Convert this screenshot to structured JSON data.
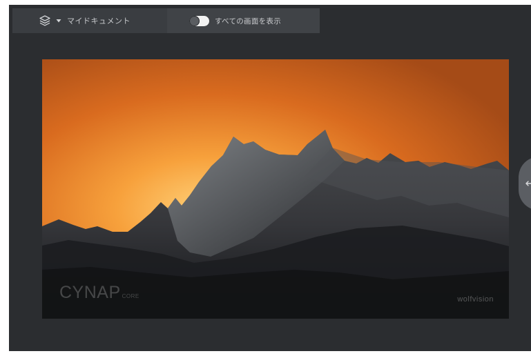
{
  "toolbar": {
    "source_label": "マイドキュメント",
    "toggle_label": "すべての画面を表示",
    "toggle_on": true
  },
  "preview": {
    "logo_main": "CYNAP",
    "logo_sub": "CORE",
    "logo_brand": "wolfvision"
  },
  "icons": {
    "source": "layers-icon",
    "caret": "caret-down-icon",
    "side_handle": "arrow-left-icon"
  }
}
